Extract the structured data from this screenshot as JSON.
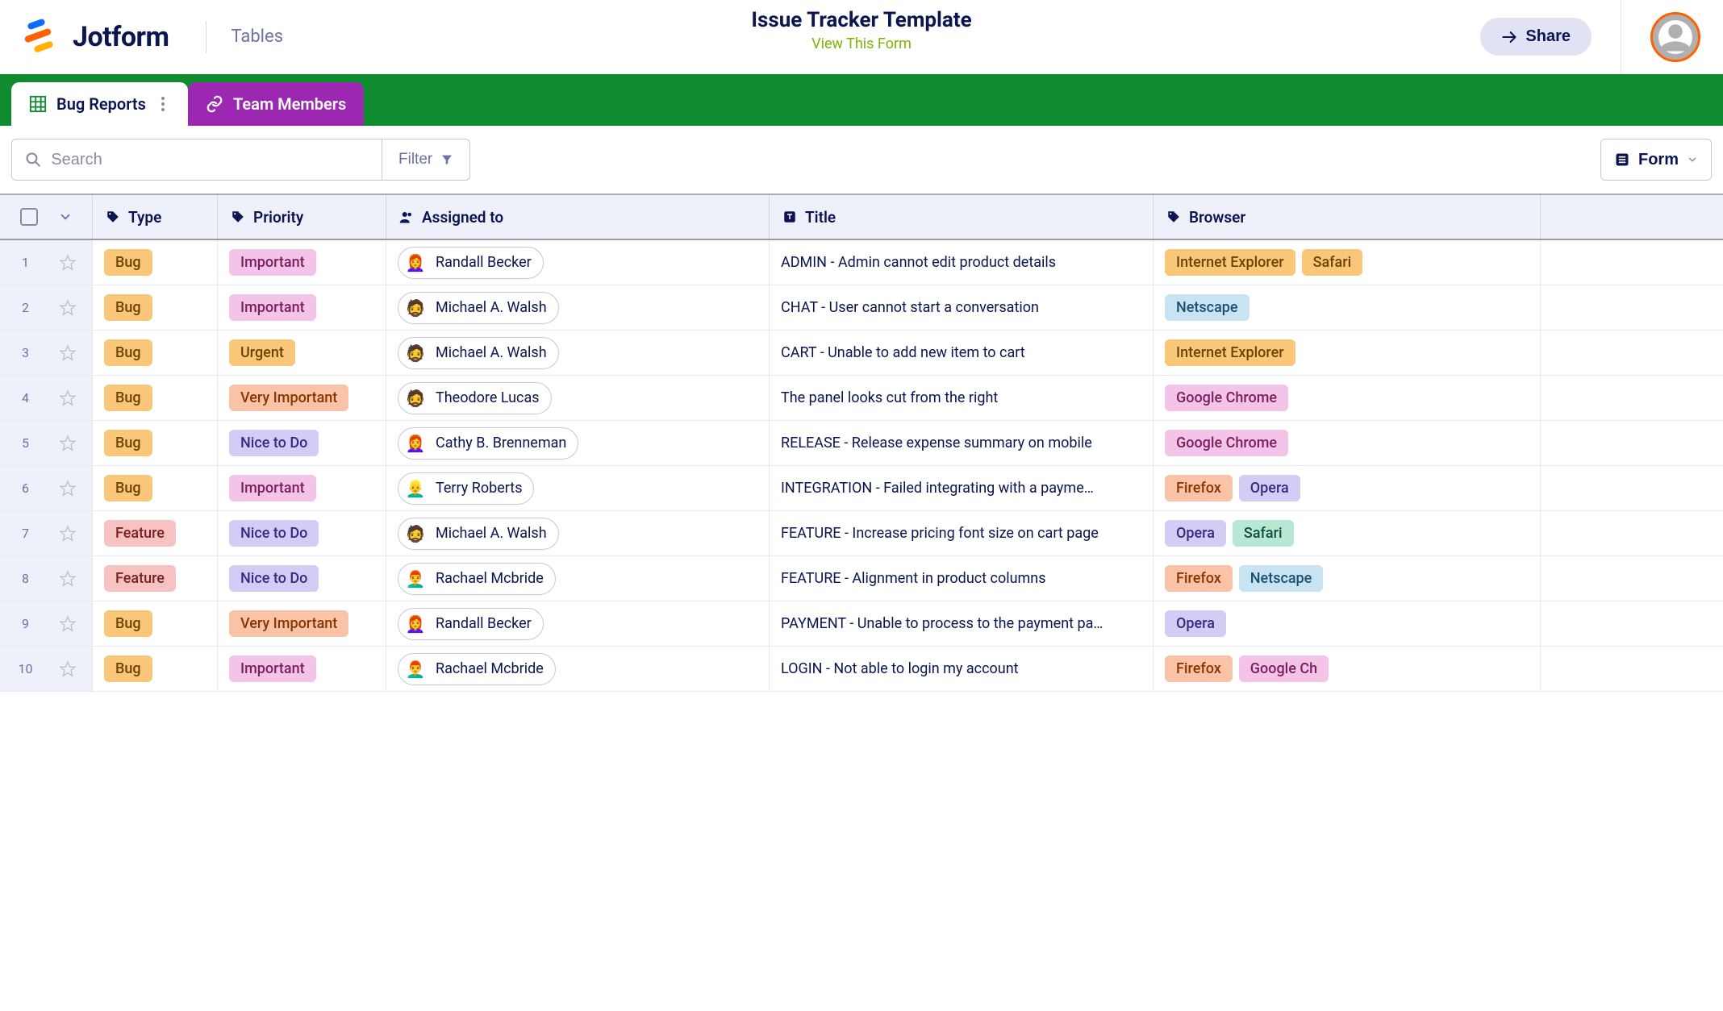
{
  "header": {
    "logo_text": "Jotform",
    "tables_label": "Tables",
    "title": "Issue Tracker Template",
    "view_link": "View This Form",
    "share_label": "Share"
  },
  "tabs": [
    {
      "label": "Bug Reports",
      "active": true
    },
    {
      "label": "Team Members",
      "active": false
    }
  ],
  "toolbar": {
    "search_placeholder": "Search",
    "filter_label": "Filter",
    "form_label": "Form"
  },
  "columns": {
    "type": "Type",
    "priority": "Priority",
    "assigned_to": "Assigned to",
    "title": "Title",
    "browser": "Browser"
  },
  "type_colors": {
    "Bug": "c-bug",
    "Feature": "c-feature"
  },
  "priority_colors": {
    "Important": "c-important",
    "Urgent": "c-urgent",
    "Very Important": "c-veryimportant",
    "Nice to Do": "c-nicetodo"
  },
  "browser_colors": {
    "Internet Explorer": "c-ie",
    "Netscape": "c-netscape",
    "Google Chrome": "c-chrome",
    "Firefox": "c-firefox",
    "Opera": "c-opera",
    "Safari": "c-safari",
    "Safari-alt": "c-safari2",
    "Google Ch": "c-chrome"
  },
  "avatar_emoji": {
    "Randall Becker": "👩‍🦰",
    "Michael A. Walsh": "🧔",
    "Theodore Lucas": "🧔",
    "Cathy B. Brenneman": "👩‍🦰",
    "Terry Roberts": "👱‍♂️",
    "Rachael Mcbride": "👨‍🦰"
  },
  "rows": [
    {
      "num": 1,
      "type": "Bug",
      "priority": "Important",
      "assignee": "Randall Becker",
      "title": "ADMIN - Admin cannot edit product details",
      "browsers": [
        "Internet Explorer",
        "Safari-alt"
      ]
    },
    {
      "num": 2,
      "type": "Bug",
      "priority": "Important",
      "assignee": "Michael A. Walsh",
      "title": "CHAT - User cannot start a conversation",
      "browsers": [
        "Netscape"
      ]
    },
    {
      "num": 3,
      "type": "Bug",
      "priority": "Urgent",
      "assignee": "Michael A. Walsh",
      "title": "CART - Unable to add new item to cart",
      "browsers": [
        "Internet Explorer"
      ]
    },
    {
      "num": 4,
      "type": "Bug",
      "priority": "Very Important",
      "assignee": "Theodore Lucas",
      "title": "The panel looks cut from the right",
      "browsers": [
        "Google Chrome"
      ]
    },
    {
      "num": 5,
      "type": "Bug",
      "priority": "Nice to Do",
      "assignee": "Cathy B. Brenneman",
      "title": "RELEASE - Release expense summary on mobile",
      "browsers": [
        "Google Chrome"
      ]
    },
    {
      "num": 6,
      "type": "Bug",
      "priority": "Important",
      "assignee": "Terry Roberts",
      "title": "INTEGRATION - Failed integrating with a payme…",
      "browsers": [
        "Firefox",
        "Opera"
      ]
    },
    {
      "num": 7,
      "type": "Feature",
      "priority": "Nice to Do",
      "assignee": "Michael A. Walsh",
      "title": "FEATURE - Increase pricing font size on cart page",
      "browsers": [
        "Opera",
        "Safari"
      ]
    },
    {
      "num": 8,
      "type": "Feature",
      "priority": "Nice to Do",
      "assignee": "Rachael Mcbride",
      "title": "FEATURE - Alignment in product columns",
      "browsers": [
        "Firefox",
        "Netscape"
      ]
    },
    {
      "num": 9,
      "type": "Bug",
      "priority": "Very Important",
      "assignee": "Randall Becker",
      "title": "PAYMENT - Unable to process to the payment pa…",
      "browsers": [
        "Opera"
      ]
    },
    {
      "num": 10,
      "type": "Bug",
      "priority": "Important",
      "assignee": "Rachael Mcbride",
      "title": "LOGIN - Not able to login my account",
      "browsers": [
        "Firefox",
        "Google Ch"
      ]
    }
  ]
}
